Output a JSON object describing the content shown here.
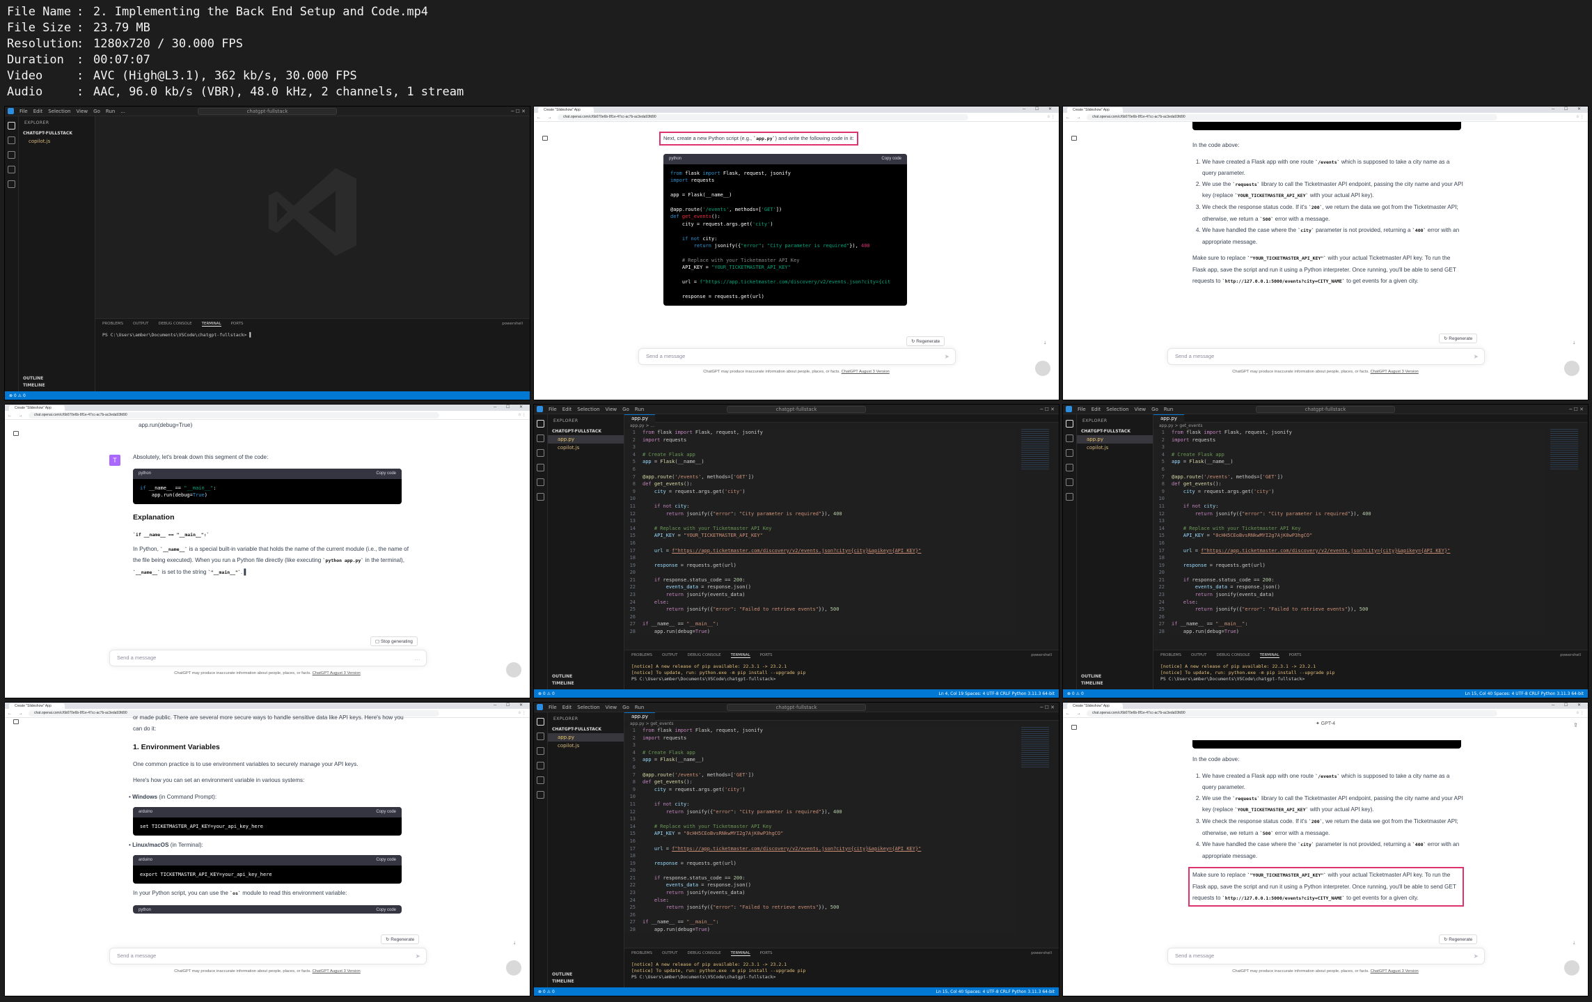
{
  "info": [
    {
      "k": "File Name",
      "v": "2. Implementing the Back End Setup and Code.mp4"
    },
    {
      "k": "File Size",
      "v": "23.79 MB"
    },
    {
      "k": "Resolution",
      "v": "1280x720 / 30.000 FPS"
    },
    {
      "k": "Duration",
      "v": "00:07:07"
    },
    {
      "k": "Video",
      "v": "AVC (High@L3.1), 362 kb/s, 30.000 FPS"
    },
    {
      "k": "Audio",
      "v": "AAC, 96.0 kb/s (VBR), 48.0 kHz, 2 channels, 1 stream"
    }
  ],
  "vscode": {
    "menu": [
      "File",
      "Edit",
      "Selection",
      "View",
      "Go",
      "Run",
      "..."
    ],
    "search": "chatgpt-fullstack",
    "explorer": "EXPLORER",
    "folder": "CHATGPT-FULLSTACK",
    "files": [
      "app.py",
      "copilot.js"
    ],
    "outline": "OUTLINE",
    "timeline": "TIMELINE",
    "panel_tabs": [
      "PROBLEMS",
      "OUTPUT",
      "DEBUG CONSOLE",
      "TERMINAL",
      "PORTS"
    ],
    "shell": "powershell",
    "prompt": "PS C:\\Users\\amber\\Documents\\VSCode\\chatgpt-fullstack>",
    "pip_1": "[notice] A new release of pip available: 22.3.1 -> 23.2.1",
    "pip_2": "[notice] To update, run: python.exe -m pip install --upgrade pip",
    "tab": "app.py",
    "crumb_1": "app.py > ...",
    "crumb_2": "app.py > get_events",
    "status_left": "⊗ 0 ⚠ 0",
    "status_right_1": "Ln 4, Col 19   Spaces: 4   UTF-8   CRLF   Python   3.11.3 64-bit",
    "status_right_2": "Ln 15, Col 40   Spaces: 4   UTF-8   CRLF   Python   3.11.3 64-bit",
    "api_key_placeholder": "YOUR_TICKETMASTER_API_KEY",
    "api_key_real": "0cHH5CEoBvsRNkwMYI2g7AjK0wP3hgCO"
  },
  "browser": {
    "tab": "Create \"Slideshow\" App",
    "url": "chat.openai.com/c/6b070e6b-8f1e-47cc-ac7b-ac3eda93fd90",
    "send_placeholder": "Send a message",
    "disclaimer": "ChatGPT may produce inaccurate information about people, places, or facts.",
    "disclaimer_link": "ChatGPT August 3 Version",
    "regenerate": "Regenerate",
    "stop": "Stop generating",
    "copy": "Copy code",
    "model": "GPT-4"
  },
  "chat1": {
    "intro_pre": "Next, create a new Python script (e.g., ",
    "intro_code": "`app.py`",
    "intro_post": ") and write the following code in it:",
    "lang": "python"
  },
  "chat2": {
    "top_line": "app.run(debug=True)",
    "in_code": "In the code above:",
    "items": [
      [
        "We have created a Flask app with one route ",
        "`/events`",
        " which is supposed to take a city name as a query parameter."
      ],
      [
        "We use the ",
        "`requests`",
        " library to call the Ticketmaster API endpoint, passing the city name and your API key (replace ",
        "`YOUR_TICKETMASTER_API_KEY`",
        " with your actual API key)."
      ],
      [
        "We check the response status code. If it's ",
        "`200`",
        ", we return the data we got from the Ticketmaster API; otherwise, we return a ",
        "`500`",
        " error with a message."
      ],
      [
        "We have handled the case where the ",
        "`city`",
        " parameter is not provided, returning a ",
        "`400`",
        " error with an appropriate message."
      ]
    ],
    "make_sure_1": "Make sure to replace ",
    "make_sure_code": "`\"YOUR_TICKETMASTER_API_KEY\"`",
    "make_sure_2": " with your actual Ticketmaster API key. To run the Flask app, save the script and run it using a Python interpreter. Once running, you'll be able to send GET requests to ",
    "make_sure_url": "`http://127.0.0.1:5000/events?city=CITY_NAME`",
    "make_sure_3": " to get events for a given city."
  },
  "chat3": {
    "top_line": "app.run(debug=True)",
    "avatar": "T",
    "msg": "Absolutely, let's break down this segment of the code:",
    "lang": "python",
    "heading": "Explanation",
    "sub": "`if __name__ == \"__main__\":`",
    "p1_a": "In Python, ",
    "p1_b": "`__name__`",
    "p1_c": " is a special built-in variable that holds the name of the current module (i.e., the name of the file being executed). When you run a Python file directly (like executing ",
    "p1_d": "`python app.py`",
    "p1_e": " in the terminal), ",
    "p1_f": "`__name__`",
    "p1_g": " is set to the string ",
    "p1_h": "`\"__main__\"`",
    "p1_i": "."
  },
  "chat4": {
    "top": "or made public. There are several more secure ways to handle sensitive data like API keys. Here's how you can do it:",
    "heading": "1. Environment Variables",
    "p1": "One common practice is to use environment variables to securely manage your API keys.",
    "p2": "Here's how you can set an environment variable in various systems:",
    "win_b": "Windows",
    "win_t": " (in Command Prompt):",
    "win_lang": "arduino",
    "win_code": "set TICKETMASTER_API_KEY=your_api_key_here",
    "lin_b": "Linux/macOS",
    "lin_t": " (in Terminal):",
    "lin_lang": "arduino",
    "lin_code": "export TICKETMASTER_API_KEY=your_api_key_here",
    "p3_a": "In your Python script, you can use the ",
    "p3_b": "`os`",
    "p3_c": " module to read this environment variable:",
    "lang": "python"
  }
}
